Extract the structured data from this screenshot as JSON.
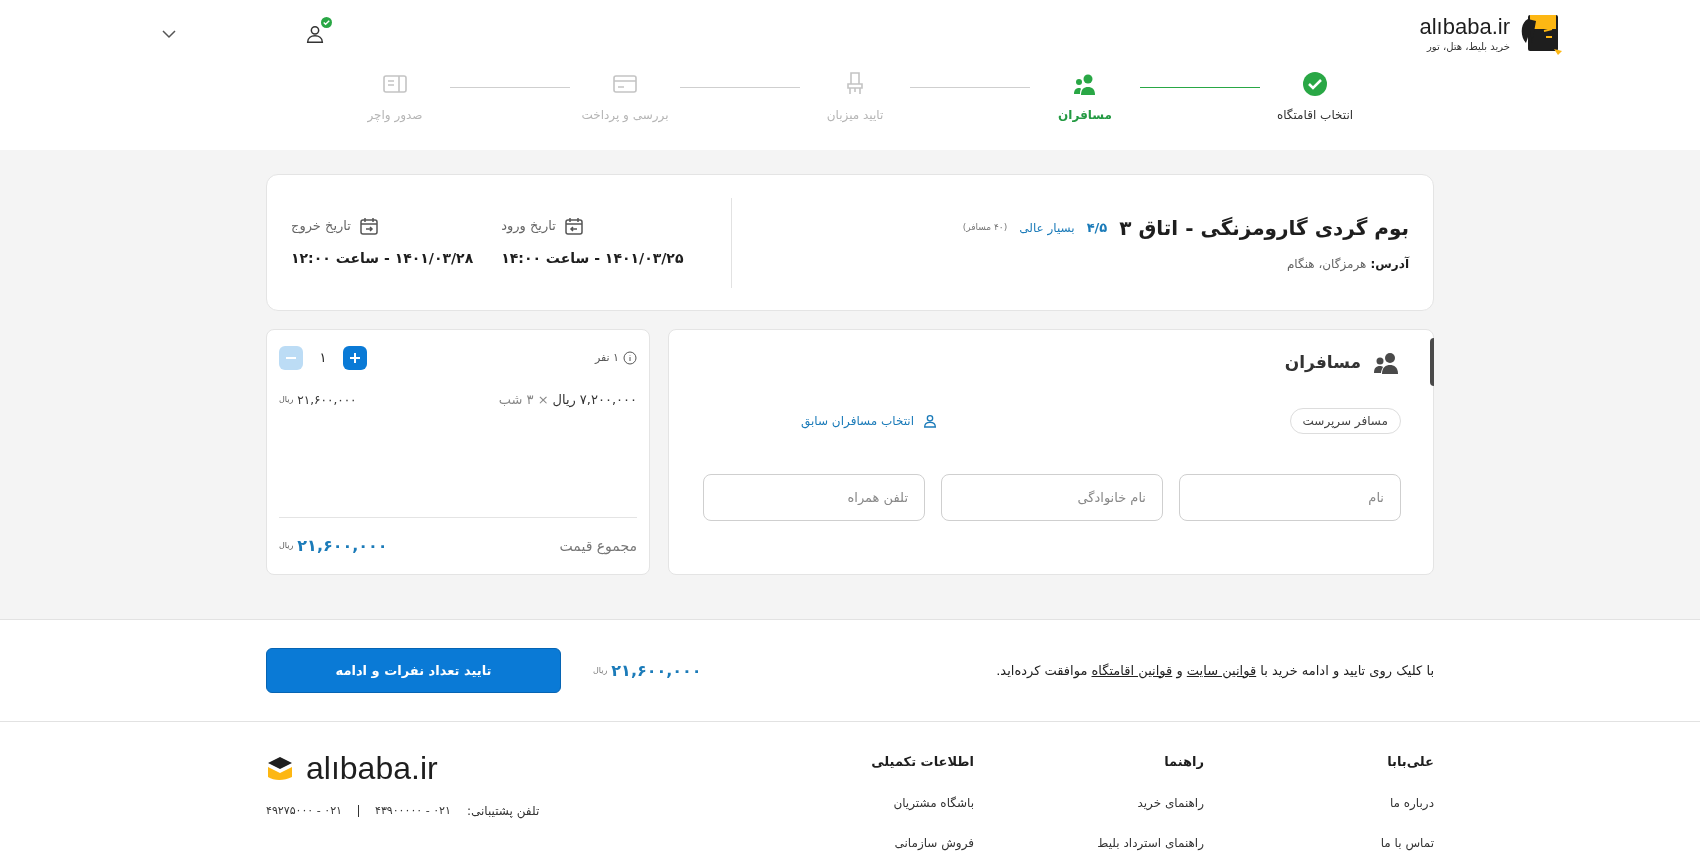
{
  "header": {
    "logo_text": "alıbaba.ir",
    "tagline": "خرید بلیط، هتل، تور",
    "user_verified": true
  },
  "steps": [
    {
      "label": "انتخاب اقامتگاه",
      "completed": true,
      "selected": false
    },
    {
      "label": "مسافران",
      "completed": false,
      "selected": true
    },
    {
      "label": "تایید میزبان",
      "completed": false,
      "selected": false
    },
    {
      "label": "بررسی و پرداخت",
      "completed": false,
      "selected": false
    },
    {
      "label": "صدور واچر",
      "completed": false,
      "selected": false
    }
  ],
  "hotel": {
    "title": "بوم گردی گارومزنگی - اتاق ۳",
    "rating": "۴/۵",
    "rating_label": "بسیار عالی",
    "reviews": "(۴۰ مسافر)",
    "address_label": "آدرس:",
    "address": "هرمزگان، هنگام"
  },
  "dates": [
    {
      "label": "تاریخ ورود",
      "value": "۱۴۰۱/۰۳/۲۵ - ساعت ۱۴:۰۰"
    },
    {
      "label": "تاریخ خروج",
      "value": "۱۴۰۱/۰۳/۲۸ - ساعت ۱۲:۰۰"
    }
  ],
  "passengers": {
    "title": "مسافران",
    "role": "مسافر سرپرست",
    "previous_link": "انتخاب مسافران سابق",
    "fields": [
      {
        "placeholder": "نام"
      },
      {
        "placeholder": "نام خانوادگی"
      },
      {
        "placeholder": "تلفن همراه"
      }
    ]
  },
  "price": {
    "count_label": "۱ نفر",
    "quantity": "۱",
    "minus_disabled": true,
    "unit_price": "۷,۲۰۰,۰۰۰",
    "unit": "ریال",
    "nights": "× ۳ شب",
    "line_total": "۲۱,۶۰۰,۰۰۰",
    "line_currency": "ریال",
    "total_label": "مجموع قیمت",
    "total": "۲۱,۶۰۰,۰۰۰",
    "total_currency": "ریال"
  },
  "confirm_bar": {
    "terms": [
      {
        "kind": "text",
        "text": "با کلیک روی تایید و ادامه خرید با"
      },
      {
        "kind": "link",
        "text": "قوانین سایت"
      },
      {
        "kind": "text",
        "text": "و"
      },
      {
        "kind": "link",
        "text": "قوانین اقامتگاه"
      },
      {
        "kind": "text",
        "text": "موافقت کرده‌اید."
      }
    ],
    "price": "۲۱,۶۰۰,۰۰۰",
    "currency": "ریال",
    "button": "تایید تعداد نفرات و ادامه"
  },
  "footer": {
    "columns": [
      {
        "title": "علی‌بابا",
        "links": [
          "درباره ما",
          "تماس با ما"
        ]
      },
      {
        "title": "راهنما",
        "links": [
          "راهنمای خرید",
          "راهنمای استرداد بلیط"
        ]
      },
      {
        "title": "اطلاعات تکمیلی",
        "links": [
          "باشگاه مشتریان",
          "فروش سازمانی"
        ]
      }
    ],
    "logo_text": "alıbaba.ir",
    "support_label": "تلفن پشتیبانی:",
    "phones": [
      "۰۲۱ - ۴۳۹۰۰۰۰۰",
      "۰۲۱ - ۴۹۲۷۵۰۰۰"
    ]
  }
}
